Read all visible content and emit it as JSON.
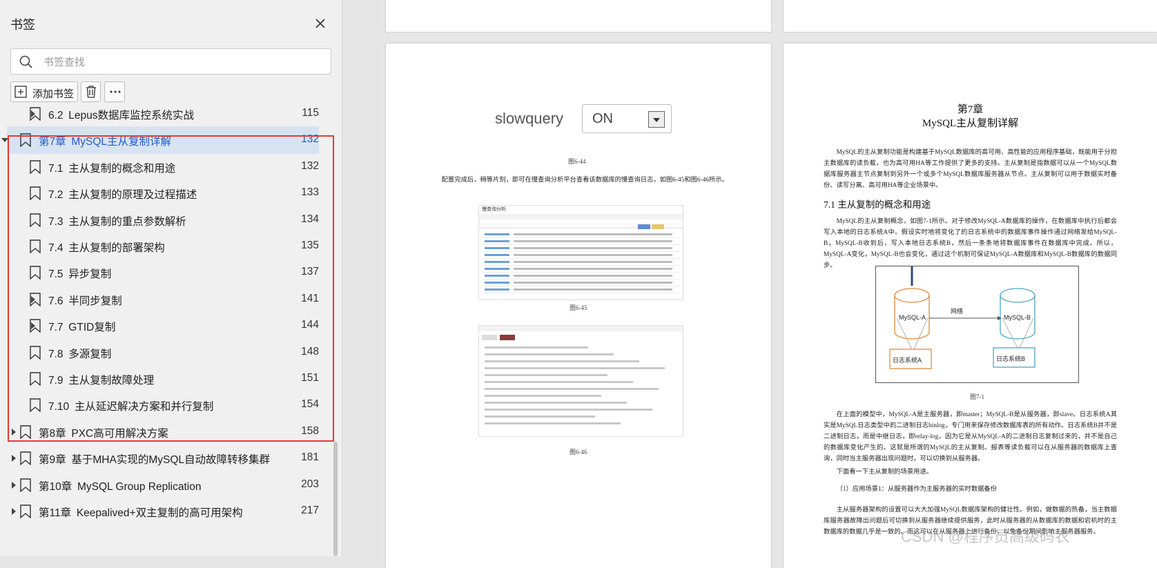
{
  "sidebar": {
    "title": "书签",
    "search_placeholder": "书签查找",
    "add_bookmark_label": "添加书签",
    "tree": [
      {
        "num": "6.2",
        "title": "Lepus数据库监控系统实战",
        "page": "115",
        "level": 1,
        "expander": "right",
        "selected": false
      },
      {
        "num": "第7章",
        "title": "MySQL主从复制详解",
        "page": "132",
        "level": 0,
        "expander": "down",
        "selected": true
      },
      {
        "num": "7.1",
        "title": "主从复制的概念和用途",
        "page": "132",
        "level": 1,
        "expander": "none",
        "selected": false
      },
      {
        "num": "7.2",
        "title": "主从复制的原理及过程描述",
        "page": "133",
        "level": 1,
        "expander": "none",
        "selected": false
      },
      {
        "num": "7.3",
        "title": "主从复制的重点参数解析",
        "page": "134",
        "level": 1,
        "expander": "none",
        "selected": false
      },
      {
        "num": "7.4",
        "title": "主从复制的部署架构",
        "page": "135",
        "level": 1,
        "expander": "none",
        "selected": false
      },
      {
        "num": "7.5",
        "title": "异步复制",
        "page": "137",
        "level": 1,
        "expander": "none",
        "selected": false
      },
      {
        "num": "7.6",
        "title": "半同步复制",
        "page": "141",
        "level": 1,
        "expander": "right",
        "selected": false
      },
      {
        "num": "7.7",
        "title": "GTID复制",
        "page": "144",
        "level": 1,
        "expander": "right",
        "selected": false
      },
      {
        "num": "7.8",
        "title": "多源复制",
        "page": "148",
        "level": 1,
        "expander": "none",
        "selected": false
      },
      {
        "num": "7.9",
        "title": "主从复制故障处理",
        "page": "151",
        "level": 1,
        "expander": "none",
        "selected": false
      },
      {
        "num": "7.10",
        "title": "主从延迟解决方案和并行复制",
        "page": "154",
        "level": 1,
        "expander": "none",
        "selected": false
      },
      {
        "num": "第8章",
        "title": "PXC高可用解决方案",
        "page": "158",
        "level": 0,
        "expander": "right",
        "selected": false
      },
      {
        "num": "第9章",
        "title": "基于MHA实现的MySQL自动故障转移集群",
        "page": "181",
        "level": 0,
        "expander": "right",
        "selected": false
      },
      {
        "num": "第10章",
        "title": "MySQL Group Replication",
        "page": "203",
        "level": 0,
        "expander": "right",
        "selected": false
      },
      {
        "num": "第11章",
        "title": "Keepalived+双主复制的高可用架构",
        "page": "217",
        "level": 0,
        "expander": "right",
        "selected": false
      }
    ]
  },
  "left_page": {
    "slowquery_label": "slowquery",
    "slowquery_value": "ON",
    "fig_644": "图6-44",
    "para1": "配置完成后，稍等片刻，即可在慢查询分析平台查看该数据库的慢查询日志，如图6-45和图6-46所示。",
    "screenshot1_title": "慢查询分析",
    "fig_645": "图6-45",
    "fig_646": "图6-46"
  },
  "right_page": {
    "chapter": "第7章",
    "chapter_title": "MySQL主从复制详解",
    "intro": "MySQL的主从复制功能是构建基于MySQL数据库的高可用、高性能的应用程序基础，既能用于分担主数据库的读负载，也为高可用HA等工作提供了更多的支持。主从复制是指数据可以从一个MySQL数据库服务器主节点复制到另外一个或多个MySQL数据库服务器从节点。主从复制可以用于数据实时备份、读写分离、高可用HA等企业场景中。",
    "section": "7.1   主从复制的概念和用途",
    "para1": "MySQL的主从复制概念，如图7-1所示。对于修改MySQL-A数据库的操作，在数据库中执行后都会写入本地的日志系统A中。假设实时地将变化了的日志系统中的数据库事件操作通过网络发给MySQL-B，MySQL-B收到后，写入本地日志系统B，然后一条条地将数据库事件在数据库中完成。所以，MySQL-A变化，MySQL-B也会变化，通过这个机制可保证MySQL-A数据库和MySQL-B数据库的数据同步。",
    "diagram": {
      "db_a": "MySQL-A",
      "db_b": "MySQL-B",
      "network": "网络",
      "log_a": "日志系统A",
      "log_b": "日志系统B"
    },
    "fig_71": "图7-1",
    "para2": "在上面的模型中，MySQL-A是主服务器，即master；MySQL-B是从服务器，即slave。日志系统A其实是MySQL日志类型中的二进制日志binlog，专门用来保存修改数据库表的所有动作。日志系统B并不是二进制日志，而是中继日志，即relay-log，因为它是从MySQL-A的二进制日志复制过来的，并不是自己的数据库变化产生的。这就是所谓的MySQL的主从复制。报表等读负载可以在从服务器的数据库上查询，同时当主服务器出现问题时，可以切换到从服务器。",
    "para3": "下面看一下主从复制的场景用途。",
    "para4": "（1）应用场景1：从服务器作为主服务器的实时数据备份",
    "para5": "主从服务器架构的设置可以大大加强MySQL数据库架构的健壮性。例如，做数据的热备，当主数据库服务器故障出问题后可切换到从服务器继续提供服务，此时从服务器的从数据库的数据和宕机时的主数据库的数据几乎是一致的。而这可以在从服务器上进行备份，以免备份期间影响主服务器服务。"
  },
  "watermark": "CSDN @程序员高级码农"
}
